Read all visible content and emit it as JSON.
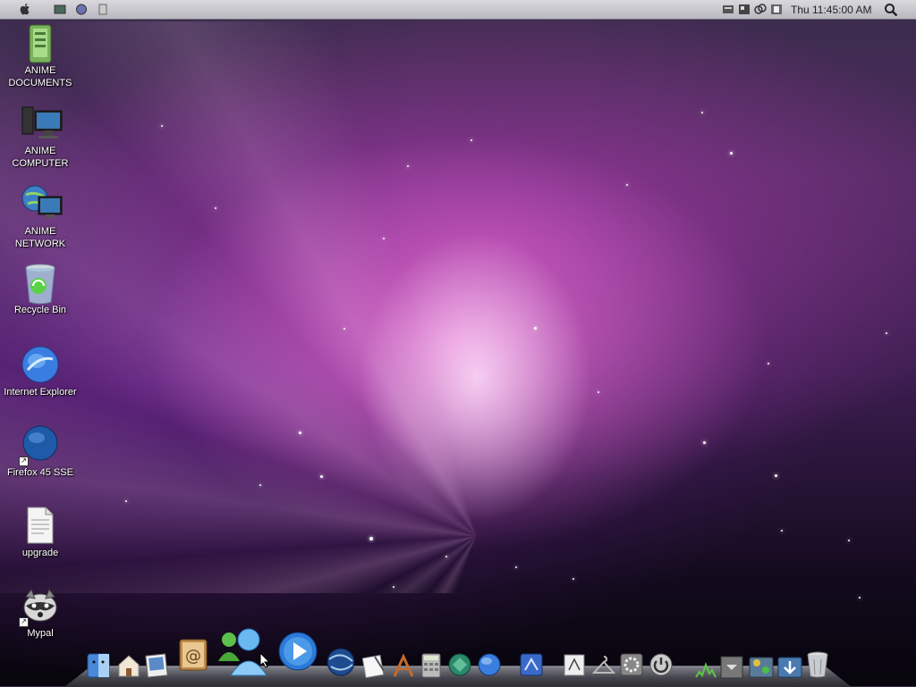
{
  "menubar": {
    "apple_glyph": "",
    "clock": "Thu 11:45:00 AM",
    "left_icons": [
      "screen-icon",
      "globe-icon",
      "script-icon"
    ],
    "right_icons": [
      "app-icon-1",
      "app-icon-2",
      "app-icon-3",
      "network-icon"
    ]
  },
  "desktop_icons": [
    {
      "name": "anime-documents",
      "label": "ANIME\nDOCUMENTS",
      "icon": "documents-folder-icon"
    },
    {
      "name": "anime-computer",
      "label": "ANIME\nCOMPUTER",
      "icon": "computer-icon"
    },
    {
      "name": "anime-network",
      "label": "ANIME NETWORK",
      "icon": "network-icon"
    },
    {
      "name": "recycle-bin",
      "label": "Recycle Bin",
      "icon": "recycle-bin-icon"
    },
    {
      "name": "internet-explorer",
      "label": "Internet Explorer",
      "icon": "internet-explorer-icon"
    },
    {
      "name": "firefox-45-sse",
      "label": "Firefox 45 SSE",
      "icon": "firefox-icon"
    },
    {
      "name": "upgrade",
      "label": "upgrade",
      "icon": "text-document-icon"
    },
    {
      "name": "mypal",
      "label": "Mypal",
      "icon": "mypal-icon"
    }
  ],
  "dock_items": [
    "finder-icon",
    "home-icon",
    "preview-icon",
    "address-book-icon",
    "messenger-icon",
    "media-player-icon",
    "world-browser-icon",
    "textedit-icon",
    "app-builder-icon",
    "calculator-icon",
    "network-utility-icon",
    "globe-icon",
    "dashboard-icon",
    "sketch-icon",
    "hanger-icon",
    "system-preferences-icon",
    "power-icon",
    "activity-monitor-icon",
    "stack-icon",
    "utilities-icon",
    "downloads-icon",
    "trash-icon"
  ],
  "colors": {
    "menubar": "#c9c8cf",
    "accent_pink": "#e070d0",
    "label_text": "#ffffff"
  }
}
